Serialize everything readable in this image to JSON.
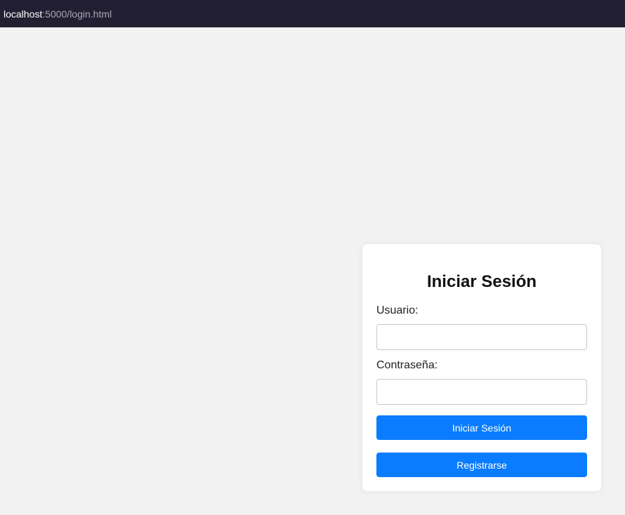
{
  "browser": {
    "url_host": "localhost",
    "url_rest": ":5000/login.html"
  },
  "login_form": {
    "title": "Iniciar Sesión",
    "username_label": "Usuario:",
    "username_value": "",
    "password_label": "Contraseña:",
    "password_value": "",
    "login_button": "Iniciar Sesión",
    "register_button": "Registrarse"
  },
  "colors": {
    "address_bar_bg": "#231f33",
    "page_bg": "#f2f2f2",
    "button_primary": "#0a7cff"
  }
}
